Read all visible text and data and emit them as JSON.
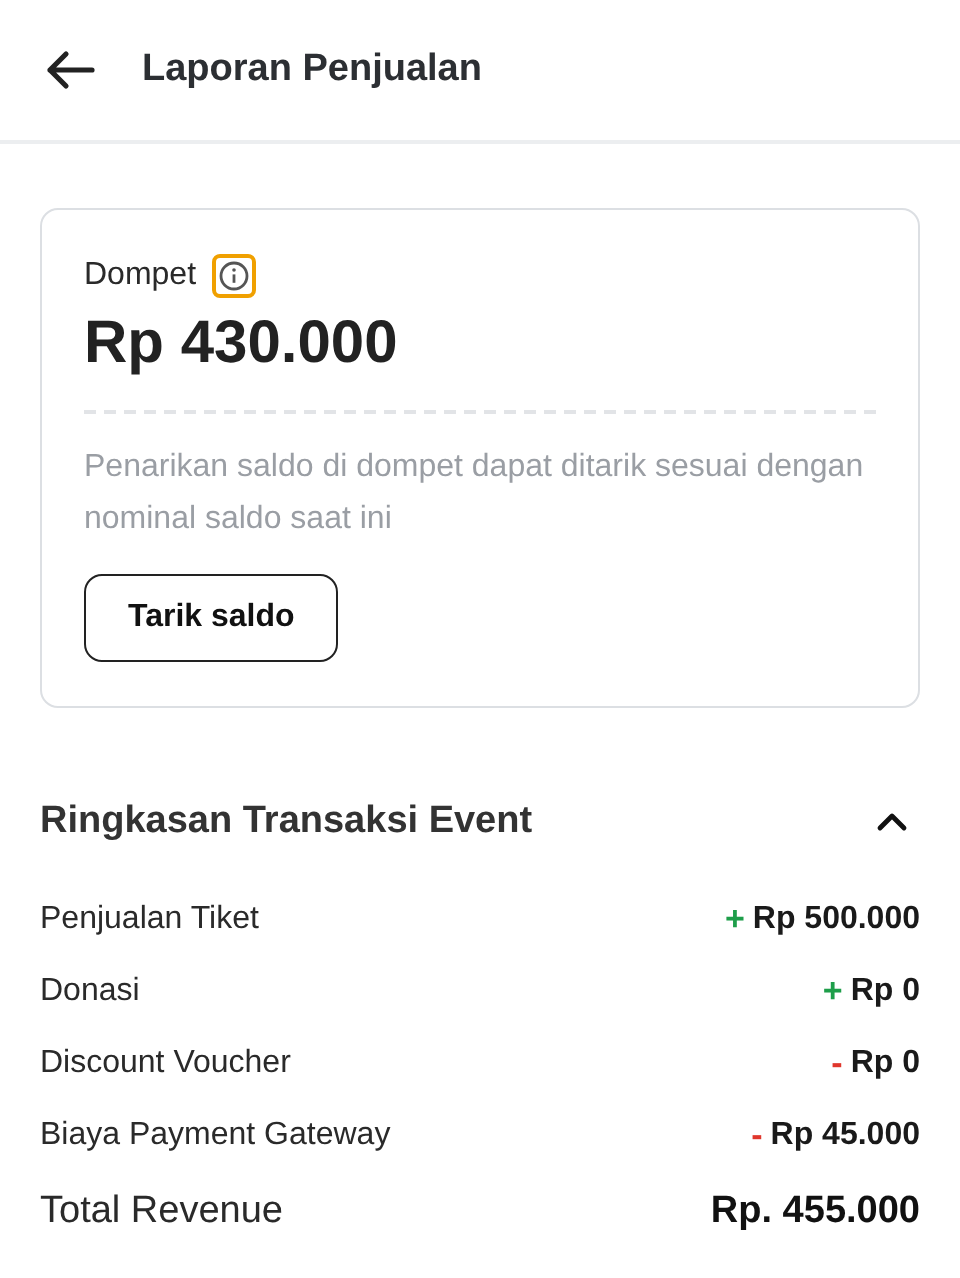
{
  "header": {
    "title": "Laporan Penjualan"
  },
  "wallet": {
    "label": "Dompet",
    "info_highlighted": true,
    "balance": "Rp 430.000",
    "note": "Penarikan saldo di dompet dapat ditarik sesuai dengan nominal saldo saat ini",
    "button": "Tarik saldo"
  },
  "summary": {
    "title": "Ringkasan Transaksi Event",
    "expanded": true,
    "rows": [
      {
        "label": "Penjualan Tiket",
        "kind": "credit",
        "sign": "+",
        "amount": "Rp 500.000"
      },
      {
        "label": "Donasi",
        "kind": "credit",
        "sign": "+",
        "amount": "Rp 0"
      },
      {
        "label": "Discount Voucher",
        "kind": "debit",
        "sign": "-",
        "amount": "Rp 0"
      },
      {
        "label": "Biaya Payment Gateway",
        "kind": "debit",
        "sign": "-",
        "amount": "Rp 45.000"
      }
    ],
    "total": {
      "label": "Total Revenue",
      "amount": "Rp. 455.000"
    }
  }
}
